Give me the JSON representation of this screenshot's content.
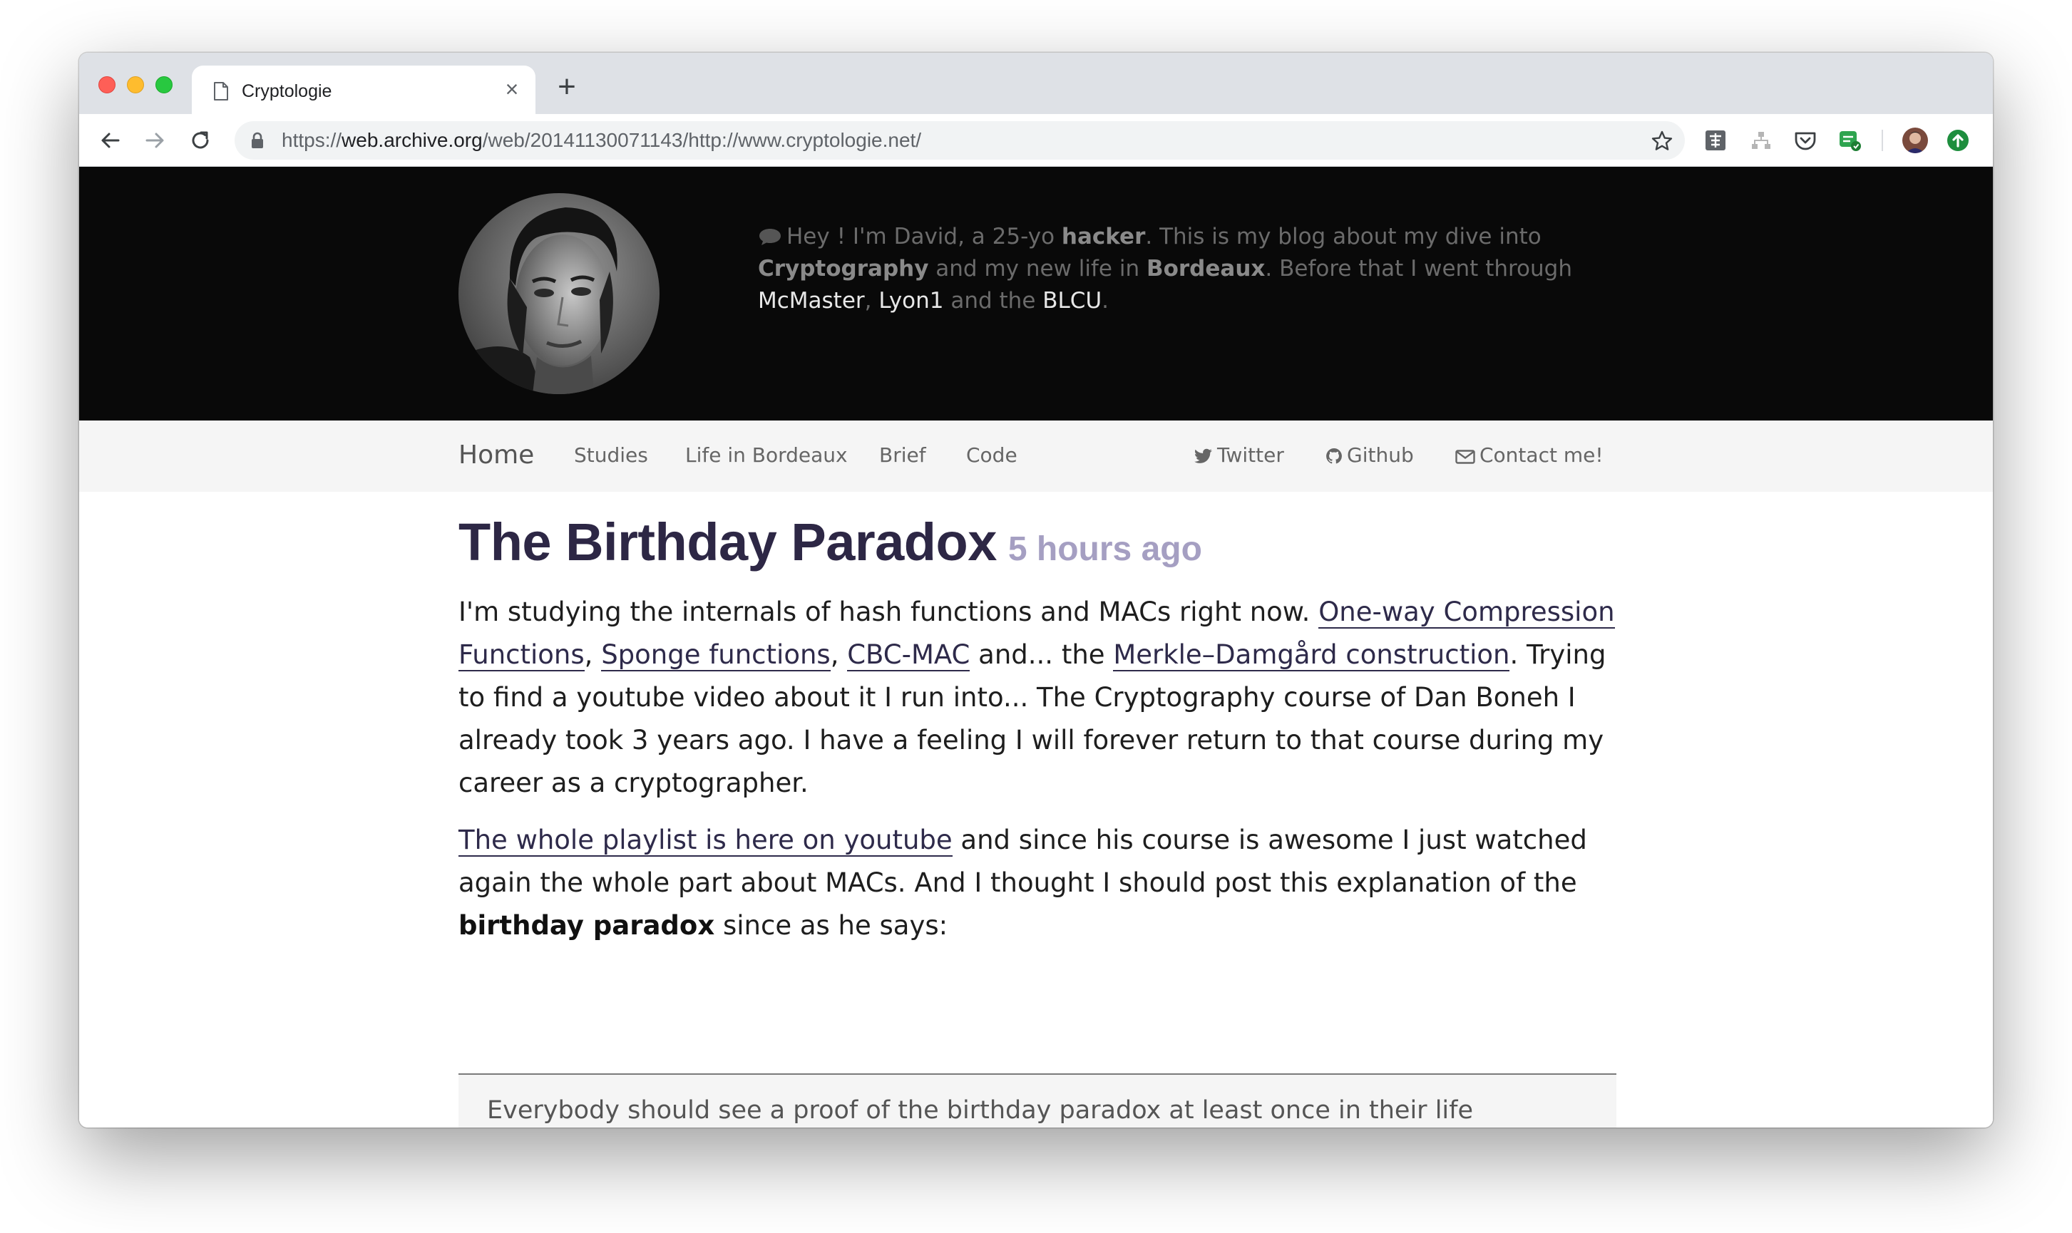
{
  "browser": {
    "tab": {
      "title": "Cryptologie",
      "close": "×"
    },
    "new_tab": "+",
    "url": {
      "scheme": "https://",
      "host": "web.archive.org",
      "path": "/web/20141130071143/http://www.cryptologie.net/"
    }
  },
  "hero": {
    "bio": {
      "intro": "Hey ! I'm David, a 25-yo ",
      "hacker": "hacker",
      "mid1": ". This is my blog about my dive into ",
      "cryptography": "Cryptography",
      "mid2": " and my new life in ",
      "bordeaux": "Bordeaux",
      "mid3": ". Before that I went through ",
      "school1": "McMaster",
      "sep1": ", ",
      "school2": "Lyon1",
      "sep2": " and the ",
      "school3": "BLCU",
      "end": "."
    }
  },
  "nav": {
    "home": "Home",
    "studies": "Studies",
    "life": "Life in Bordeaux",
    "brief": "Brief",
    "code": "Code",
    "twitter": "Twitter",
    "github": "Github",
    "contact": "Contact me!"
  },
  "post": {
    "title": "The Birthday Paradox",
    "ago": "5 hours ago",
    "p1": {
      "a": "I'm studying the internals of hash functions and MACs right now. ",
      "link1": "One-way Compression Functions",
      "b": ", ",
      "link2": "Sponge functions",
      "c": ", ",
      "link3": "CBC-MAC",
      "d": " and... the ",
      "link4": "Merkle–Damgård construction",
      "e": ". Trying to find a youtube video about it I run into... The Cryptography course of Dan Boneh I already took 3 years ago. I have a feeling I will forever return to that course during my career as a cryptographer."
    },
    "p2": {
      "link": "The whole playlist is here on youtube",
      "a": " and since his course is awesome I just watched again the whole part about MACs. And I thought I should post this explanation of the ",
      "bold": "birthday paradox",
      "b": " since as he says:"
    },
    "quote": "Everybody should see a proof of the birthday paradox at least once in their life"
  },
  "colors": {
    "title": "#2d2745",
    "subtitle": "#a59fc2",
    "hero_bg": "#090909",
    "navbar_bg": "#f5f5f5"
  },
  "icons": [
    "document-icon",
    "back-arrow-icon",
    "forward-arrow-icon",
    "reload-icon",
    "lock-icon",
    "bookmark-star-icon",
    "speech-bubble-icon",
    "twitter-icon",
    "github-icon",
    "envelope-icon"
  ]
}
